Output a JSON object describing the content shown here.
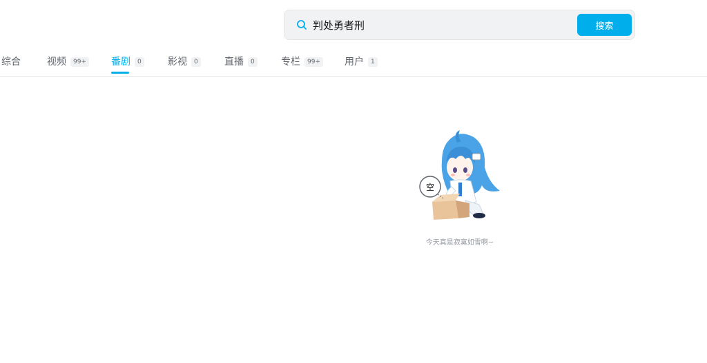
{
  "search": {
    "query": "判处勇者刑",
    "button_label": "搜索"
  },
  "tabs": [
    {
      "label": "综合",
      "count": ""
    },
    {
      "label": "视频",
      "count": "99+"
    },
    {
      "label": "番剧",
      "count": "0",
      "active": true
    },
    {
      "label": "影视",
      "count": "0"
    },
    {
      "label": "直播",
      "count": "0"
    },
    {
      "label": "专栏",
      "count": "99+"
    },
    {
      "label": "用户",
      "count": "1"
    }
  ],
  "empty_state": {
    "bubble_text": "空",
    "message": "今天真是寂寞如雪啊~"
  },
  "colors": {
    "accent": "#00aeec",
    "muted_text": "#9499a0"
  }
}
